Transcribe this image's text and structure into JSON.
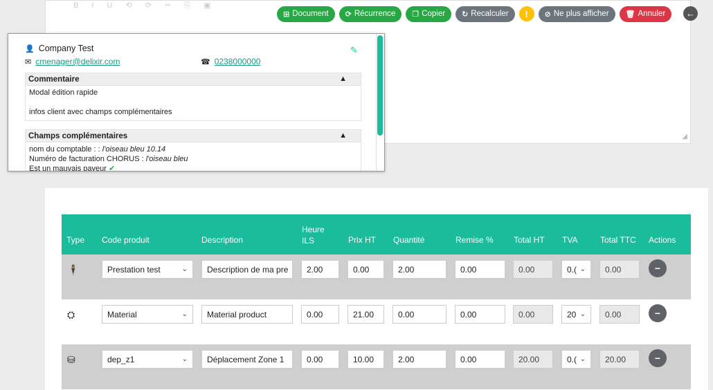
{
  "toolbar": {
    "document": "Document",
    "recurrence": "Récurrence",
    "copy": "Copier",
    "recalc": "Recalculer",
    "warning": "!",
    "hide": "Ne plus afficher",
    "cancel": "Annuler"
  },
  "client": {
    "name": "Company Test",
    "email": "cmenager@delixir.com",
    "phone": "0238000000"
  },
  "comment": {
    "title": "Commentaire",
    "line1": "Modal édition rapide",
    "line2": "infos client avec champs complémentaires"
  },
  "extra": {
    "title": "Champs complémentaires",
    "f1_label": "nom du comptable :  : ",
    "f1_value": "l'oiseau bleu 10.14",
    "f2_label": "Numéro de facturation CHORUS : ",
    "f2_value": "l'oiseau bleu",
    "f3_label": "Est un mauvais payeur "
  },
  "table": {
    "headers": {
      "type": "Type",
      "code": "Code produit",
      "desc": "Description",
      "hour_l1": "Heure",
      "hour_l2": "ILS",
      "price": "Prix HT",
      "qty": "Quantité",
      "discount": "Remise %",
      "total_ht": "Total HT",
      "tva": "TVA",
      "total_ttc": "Total TTC",
      "actions": "Actions"
    },
    "rows": [
      {
        "code": "Prestation test",
        "desc": "Description de ma pre",
        "hour": "2.00",
        "price": "0.00",
        "qty": "2.00",
        "discount": "0.00",
        "total_ht": "0.00",
        "tva": "0.(",
        "total_ttc": "0.00"
      },
      {
        "code": "Material",
        "desc": "Material product",
        "hour": "0.00",
        "price": "21.00",
        "qty": "0.00",
        "discount": "0.00",
        "total_ht": "0.00",
        "tva": "20",
        "total_ttc": "0.00"
      },
      {
        "code": "dep_z1",
        "desc": "Déplacement Zone 1",
        "hour": "0.00",
        "price": "10.00",
        "qty": "2.00",
        "discount": "0.00",
        "total_ht": "20.00",
        "tva": "0.(",
        "total_ttc": "20.00"
      }
    ]
  }
}
